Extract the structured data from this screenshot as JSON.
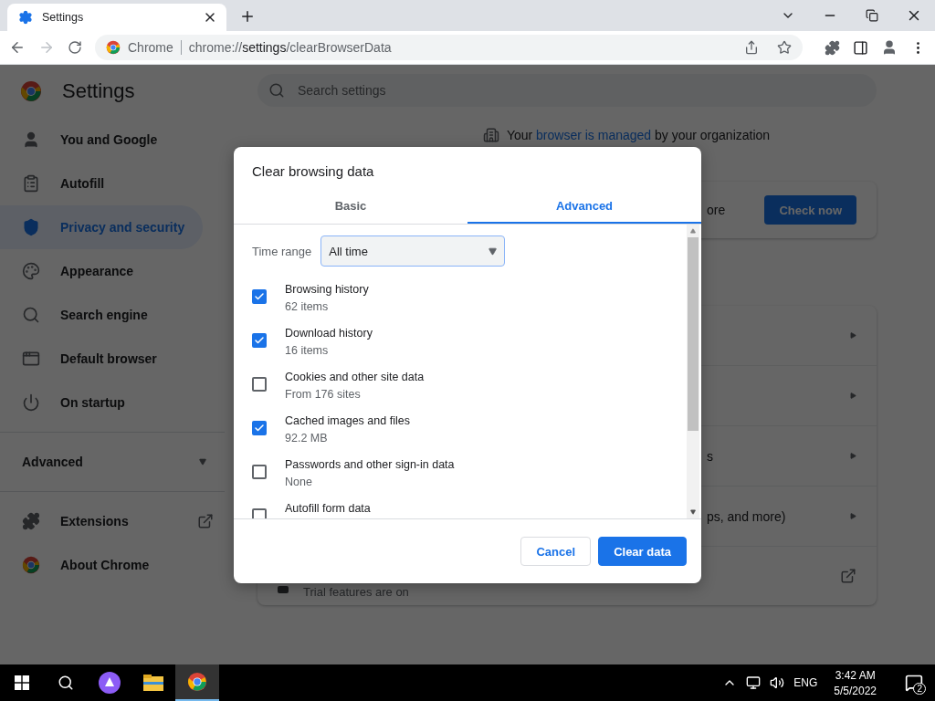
{
  "browser": {
    "tab_title": "Settings",
    "omnibox_site": "Chrome",
    "url_prefix": "chrome://",
    "url_host": "settings",
    "url_path": "/clearBrowserData"
  },
  "settings": {
    "title": "Settings",
    "search_placeholder": "Search settings",
    "nav": [
      {
        "label": "You and Google",
        "selected": false
      },
      {
        "label": "Autofill",
        "selected": false
      },
      {
        "label": "Privacy and security",
        "selected": true
      },
      {
        "label": "Appearance",
        "selected": false
      },
      {
        "label": "Search engine",
        "selected": false
      },
      {
        "label": "Default browser",
        "selected": false
      },
      {
        "label": "On startup",
        "selected": false
      }
    ],
    "advanced": {
      "label": "Advanced",
      "expanded": false
    },
    "nav_bottom": [
      {
        "label": "Extensions",
        "external": true
      },
      {
        "label": "About Chrome",
        "external": false
      }
    ],
    "managed": {
      "prefix": "Your ",
      "link": "browser is managed",
      "suffix": " by your organization"
    },
    "safety_card": {
      "text": "ore",
      "button": "Check now"
    },
    "privacy_rows": [
      {
        "text": ""
      },
      {
        "text": ""
      },
      {
        "text": "s"
      },
      {
        "text": "ps, and more)"
      }
    ],
    "trial_row": {
      "text": "Trial features are on"
    }
  },
  "dialog": {
    "title": "Clear browsing data",
    "tabs": [
      {
        "label": "Basic",
        "selected": false
      },
      {
        "label": "Advanced",
        "selected": true
      }
    ],
    "time_range": {
      "label": "Time range",
      "value": "All time"
    },
    "items": [
      {
        "title": "Browsing history",
        "detail": "62 items",
        "checked": true
      },
      {
        "title": "Download history",
        "detail": "16 items",
        "checked": true
      },
      {
        "title": "Cookies and other site data",
        "detail": "From 176 sites",
        "checked": false
      },
      {
        "title": "Cached images and files",
        "detail": "92.2 MB",
        "checked": true
      },
      {
        "title": "Passwords and other sign-in data",
        "detail": "None",
        "checked": false
      },
      {
        "title": "Autofill form data",
        "checked": false
      }
    ],
    "buttons": [
      {
        "label": "Cancel",
        "kind": "secondary"
      },
      {
        "label": "Clear data",
        "kind": "primary"
      }
    ]
  },
  "taskbar": {
    "language": "ENG",
    "time": "3:42 AM",
    "date": "5/5/2022",
    "notifications": "2"
  }
}
